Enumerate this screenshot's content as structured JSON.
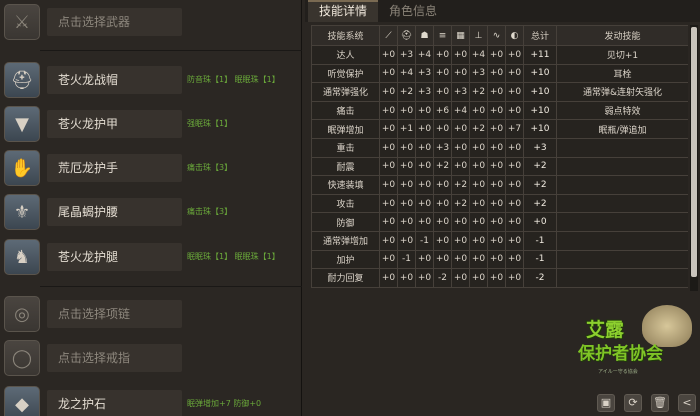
{
  "tabs": {
    "active": "技能详情",
    "inactive": "角色信息"
  },
  "slots": [
    {
      "name": "点击选择武器",
      "placeholder": true,
      "deco": "",
      "icon": "weapon-icon",
      "glyph": "⚔"
    },
    {
      "name": "苍火龙战帽",
      "placeholder": false,
      "deco": "防音珠【1】  眠眠珠【1】",
      "icon": "helmet-icon",
      "glyph": "⛑"
    },
    {
      "name": "苍火龙护甲",
      "placeholder": false,
      "deco": "强眠珠【1】",
      "icon": "chest-armor-icon",
      "glyph": "▼"
    },
    {
      "name": "荒厄龙护手",
      "placeholder": false,
      "deco": "痛击珠【3】",
      "icon": "gauntlet-icon",
      "glyph": "✋"
    },
    {
      "name": "尾晶蝎护腰",
      "placeholder": false,
      "deco": "痛击珠【3】",
      "icon": "waist-armor-icon",
      "glyph": "⚜"
    },
    {
      "name": "苍火龙护腿",
      "placeholder": false,
      "deco": "眠眠珠【1】  眠眠珠【1】",
      "icon": "leg-armor-icon",
      "glyph": "♞"
    },
    {
      "name": "点击选择项链",
      "placeholder": true,
      "deco": "",
      "icon": "necklace-icon",
      "glyph": "◎"
    },
    {
      "name": "点击选择戒指",
      "placeholder": true,
      "deco": "",
      "icon": "ring-icon",
      "glyph": "◯"
    },
    {
      "name": "龙之护石",
      "placeholder": false,
      "deco": "眠弹增加+7  防御+0",
      "icon": "charm-icon",
      "glyph": "◆"
    }
  ],
  "table": {
    "headers": {
      "system": "技能系统",
      "icons": [
        "weapon-icon",
        "helmet-icon",
        "chest-icon",
        "arm-icon",
        "waist-icon",
        "leg-icon",
        "necklace-icon",
        "ring-icon"
      ],
      "glyphs": [
        "⟋",
        "⛑",
        "☗",
        "≡",
        "▦",
        "⊥",
        "∿",
        "◐"
      ],
      "total": "总计",
      "skill": "发动技能"
    },
    "rows": [
      {
        "system": "达人",
        "vals": [
          "+0",
          "+3",
          "+4",
          "+0",
          "+0",
          "+4",
          "+0",
          "+0"
        ],
        "total": "+11",
        "skill": "见切+1"
      },
      {
        "system": "听觉保护",
        "vals": [
          "+0",
          "+4",
          "+3",
          "+0",
          "+0",
          "+3",
          "+0",
          "+0"
        ],
        "total": "+10",
        "skill": "耳栓"
      },
      {
        "system": "通常弹强化",
        "vals": [
          "+0",
          "+2",
          "+3",
          "+0",
          "+3",
          "+2",
          "+0",
          "+0"
        ],
        "total": "+10",
        "skill": "通常弹&连射矢强化"
      },
      {
        "system": "痛击",
        "vals": [
          "+0",
          "+0",
          "+0",
          "+6",
          "+4",
          "+0",
          "+0",
          "+0"
        ],
        "total": "+10",
        "skill": "弱点特效"
      },
      {
        "system": "眠弹增加",
        "vals": [
          "+0",
          "+1",
          "+0",
          "+0",
          "+0",
          "+2",
          "+0",
          "+7"
        ],
        "total": "+10",
        "skill": "眠瓶/弹追加"
      },
      {
        "system": "重击",
        "vals": [
          "+0",
          "+0",
          "+0",
          "+3",
          "+0",
          "+0",
          "+0",
          "+0"
        ],
        "total": "+3",
        "skill": ""
      },
      {
        "system": "耐震",
        "vals": [
          "+0",
          "+0",
          "+0",
          "+2",
          "+0",
          "+0",
          "+0",
          "+0"
        ],
        "total": "+2",
        "skill": ""
      },
      {
        "system": "快速装填",
        "vals": [
          "+0",
          "+0",
          "+0",
          "+0",
          "+2",
          "+0",
          "+0",
          "+0"
        ],
        "total": "+2",
        "skill": ""
      },
      {
        "system": "攻击",
        "vals": [
          "+0",
          "+0",
          "+0",
          "+0",
          "+2",
          "+0",
          "+0",
          "+0"
        ],
        "total": "+2",
        "skill": ""
      },
      {
        "system": "防御",
        "vals": [
          "+0",
          "+0",
          "+0",
          "+0",
          "+0",
          "+0",
          "+0",
          "+0"
        ],
        "total": "+0",
        "skill": ""
      },
      {
        "system": "通常弹增加",
        "vals": [
          "+0",
          "+0",
          "-1",
          "+0",
          "+0",
          "+0",
          "+0",
          "+0"
        ],
        "total": "-1",
        "skill": ""
      },
      {
        "system": "加护",
        "vals": [
          "+0",
          "-1",
          "+0",
          "+0",
          "+0",
          "+0",
          "+0",
          "+0"
        ],
        "total": "-1",
        "skill": ""
      },
      {
        "system": "耐力回复",
        "vals": [
          "+0",
          "+0",
          "+0",
          "-2",
          "+0",
          "+0",
          "+0",
          "+0"
        ],
        "total": "-2",
        "skill": ""
      }
    ]
  },
  "logo": {
    "line1": "艾露",
    "line2": "保护者协会",
    "line3": "アイルー守る協会"
  },
  "buttons": [
    {
      "name": "save-button",
      "glyph": "▣"
    },
    {
      "name": "refresh-button",
      "glyph": "⟳"
    },
    {
      "name": "delete-button",
      "glyph": "🗑"
    },
    {
      "name": "share-button",
      "glyph": "<"
    }
  ]
}
